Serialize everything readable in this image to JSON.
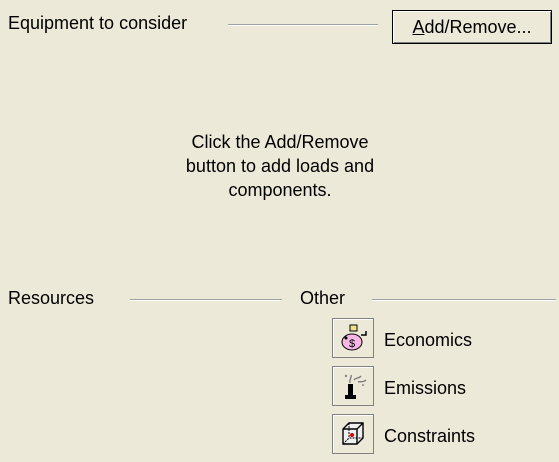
{
  "equipment": {
    "label": "Equipment to consider",
    "add_remove_prefix": "A",
    "add_remove_rest": "dd/Remove...",
    "hint": "Click the Add/Remove\nbutton to add loads and\ncomponents."
  },
  "resources": {
    "label": "Resources"
  },
  "other": {
    "label": "Other",
    "items": [
      {
        "label": "Economics",
        "icon": "economics-icon"
      },
      {
        "label": "Emissions",
        "icon": "emissions-icon"
      },
      {
        "label": "Constraints",
        "icon": "constraints-icon"
      }
    ]
  }
}
